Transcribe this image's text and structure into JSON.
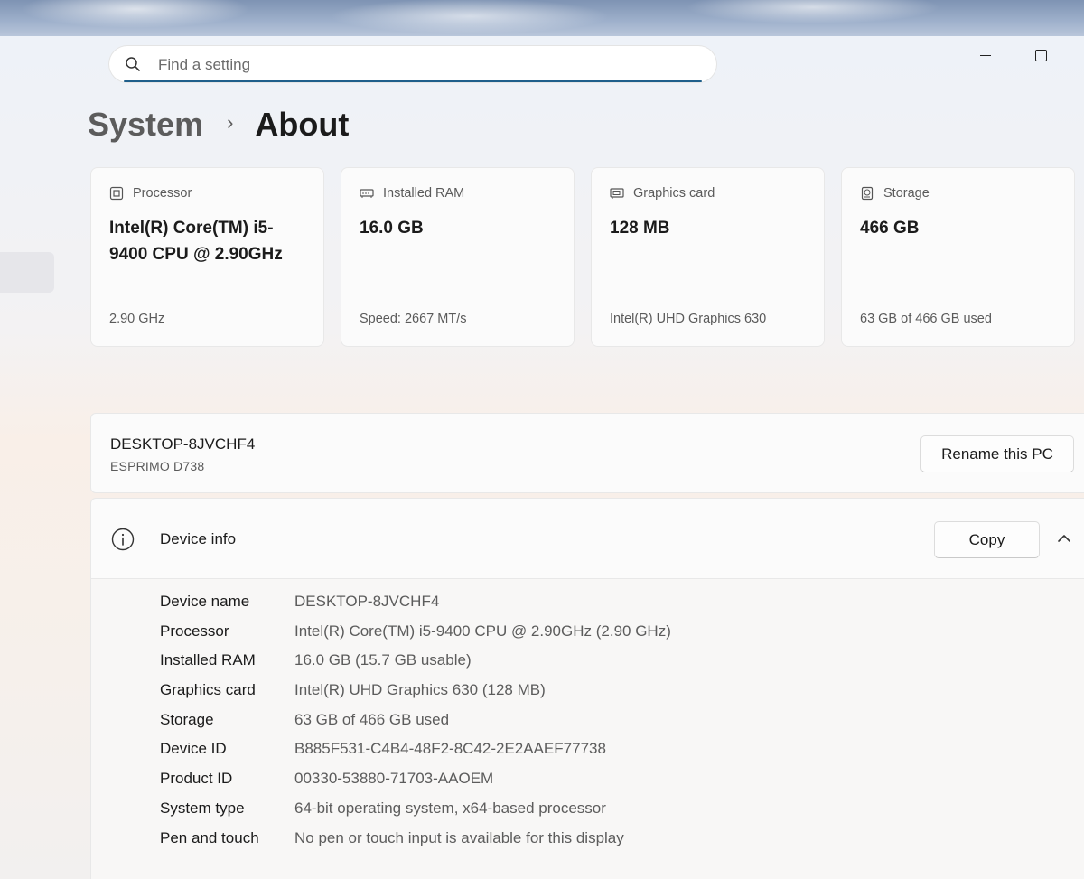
{
  "search": {
    "placeholder": "Find a setting"
  },
  "window_controls": {
    "minimize": "minimize",
    "maximize": "maximize"
  },
  "breadcrumb": {
    "parent": "System",
    "separator": "›",
    "current": "About"
  },
  "cards": [
    {
      "icon": "processor-icon",
      "label": "Processor",
      "value": "Intel(R) Core(TM) i5-9400 CPU @ 2.90GHz",
      "sub": "2.90 GHz"
    },
    {
      "icon": "ram-icon",
      "label": "Installed RAM",
      "value": "16.0 GB",
      "sub": "Speed: 2667 MT/s"
    },
    {
      "icon": "graphics-card-icon",
      "label": "Graphics card",
      "value": "128 MB",
      "sub": "Intel(R) UHD Graphics 630"
    },
    {
      "icon": "storage-icon",
      "label": "Storage",
      "value": "466 GB",
      "sub": "63 GB of 466 GB used"
    }
  ],
  "pc": {
    "name": "DESKTOP-8JVCHF4",
    "model": "ESPRIMO D738",
    "rename_label": "Rename this PC"
  },
  "device_info": {
    "title": "Device info",
    "copy_label": "Copy",
    "specs": [
      {
        "key": "Device name",
        "value": "DESKTOP-8JVCHF4"
      },
      {
        "key": "Processor",
        "value": "Intel(R) Core(TM) i5-9400 CPU @ 2.90GHz (2.90 GHz)"
      },
      {
        "key": "Installed RAM",
        "value": "16.0 GB (15.7 GB usable)"
      },
      {
        "key": "Graphics card",
        "value": "Intel(R) UHD Graphics 630 (128 MB)"
      },
      {
        "key": "Storage",
        "value": "63 GB of 466 GB used"
      },
      {
        "key": "Device ID",
        "value": "B885F531-C4B4-48F2-8C42-2E2AAEF77738"
      },
      {
        "key": "Product ID",
        "value": "00330-53880-71703-AAOEM"
      },
      {
        "key": "System type",
        "value": "64-bit operating system, x64-based processor"
      },
      {
        "key": "Pen and touch",
        "value": "No pen or touch input is available for this display"
      }
    ]
  }
}
